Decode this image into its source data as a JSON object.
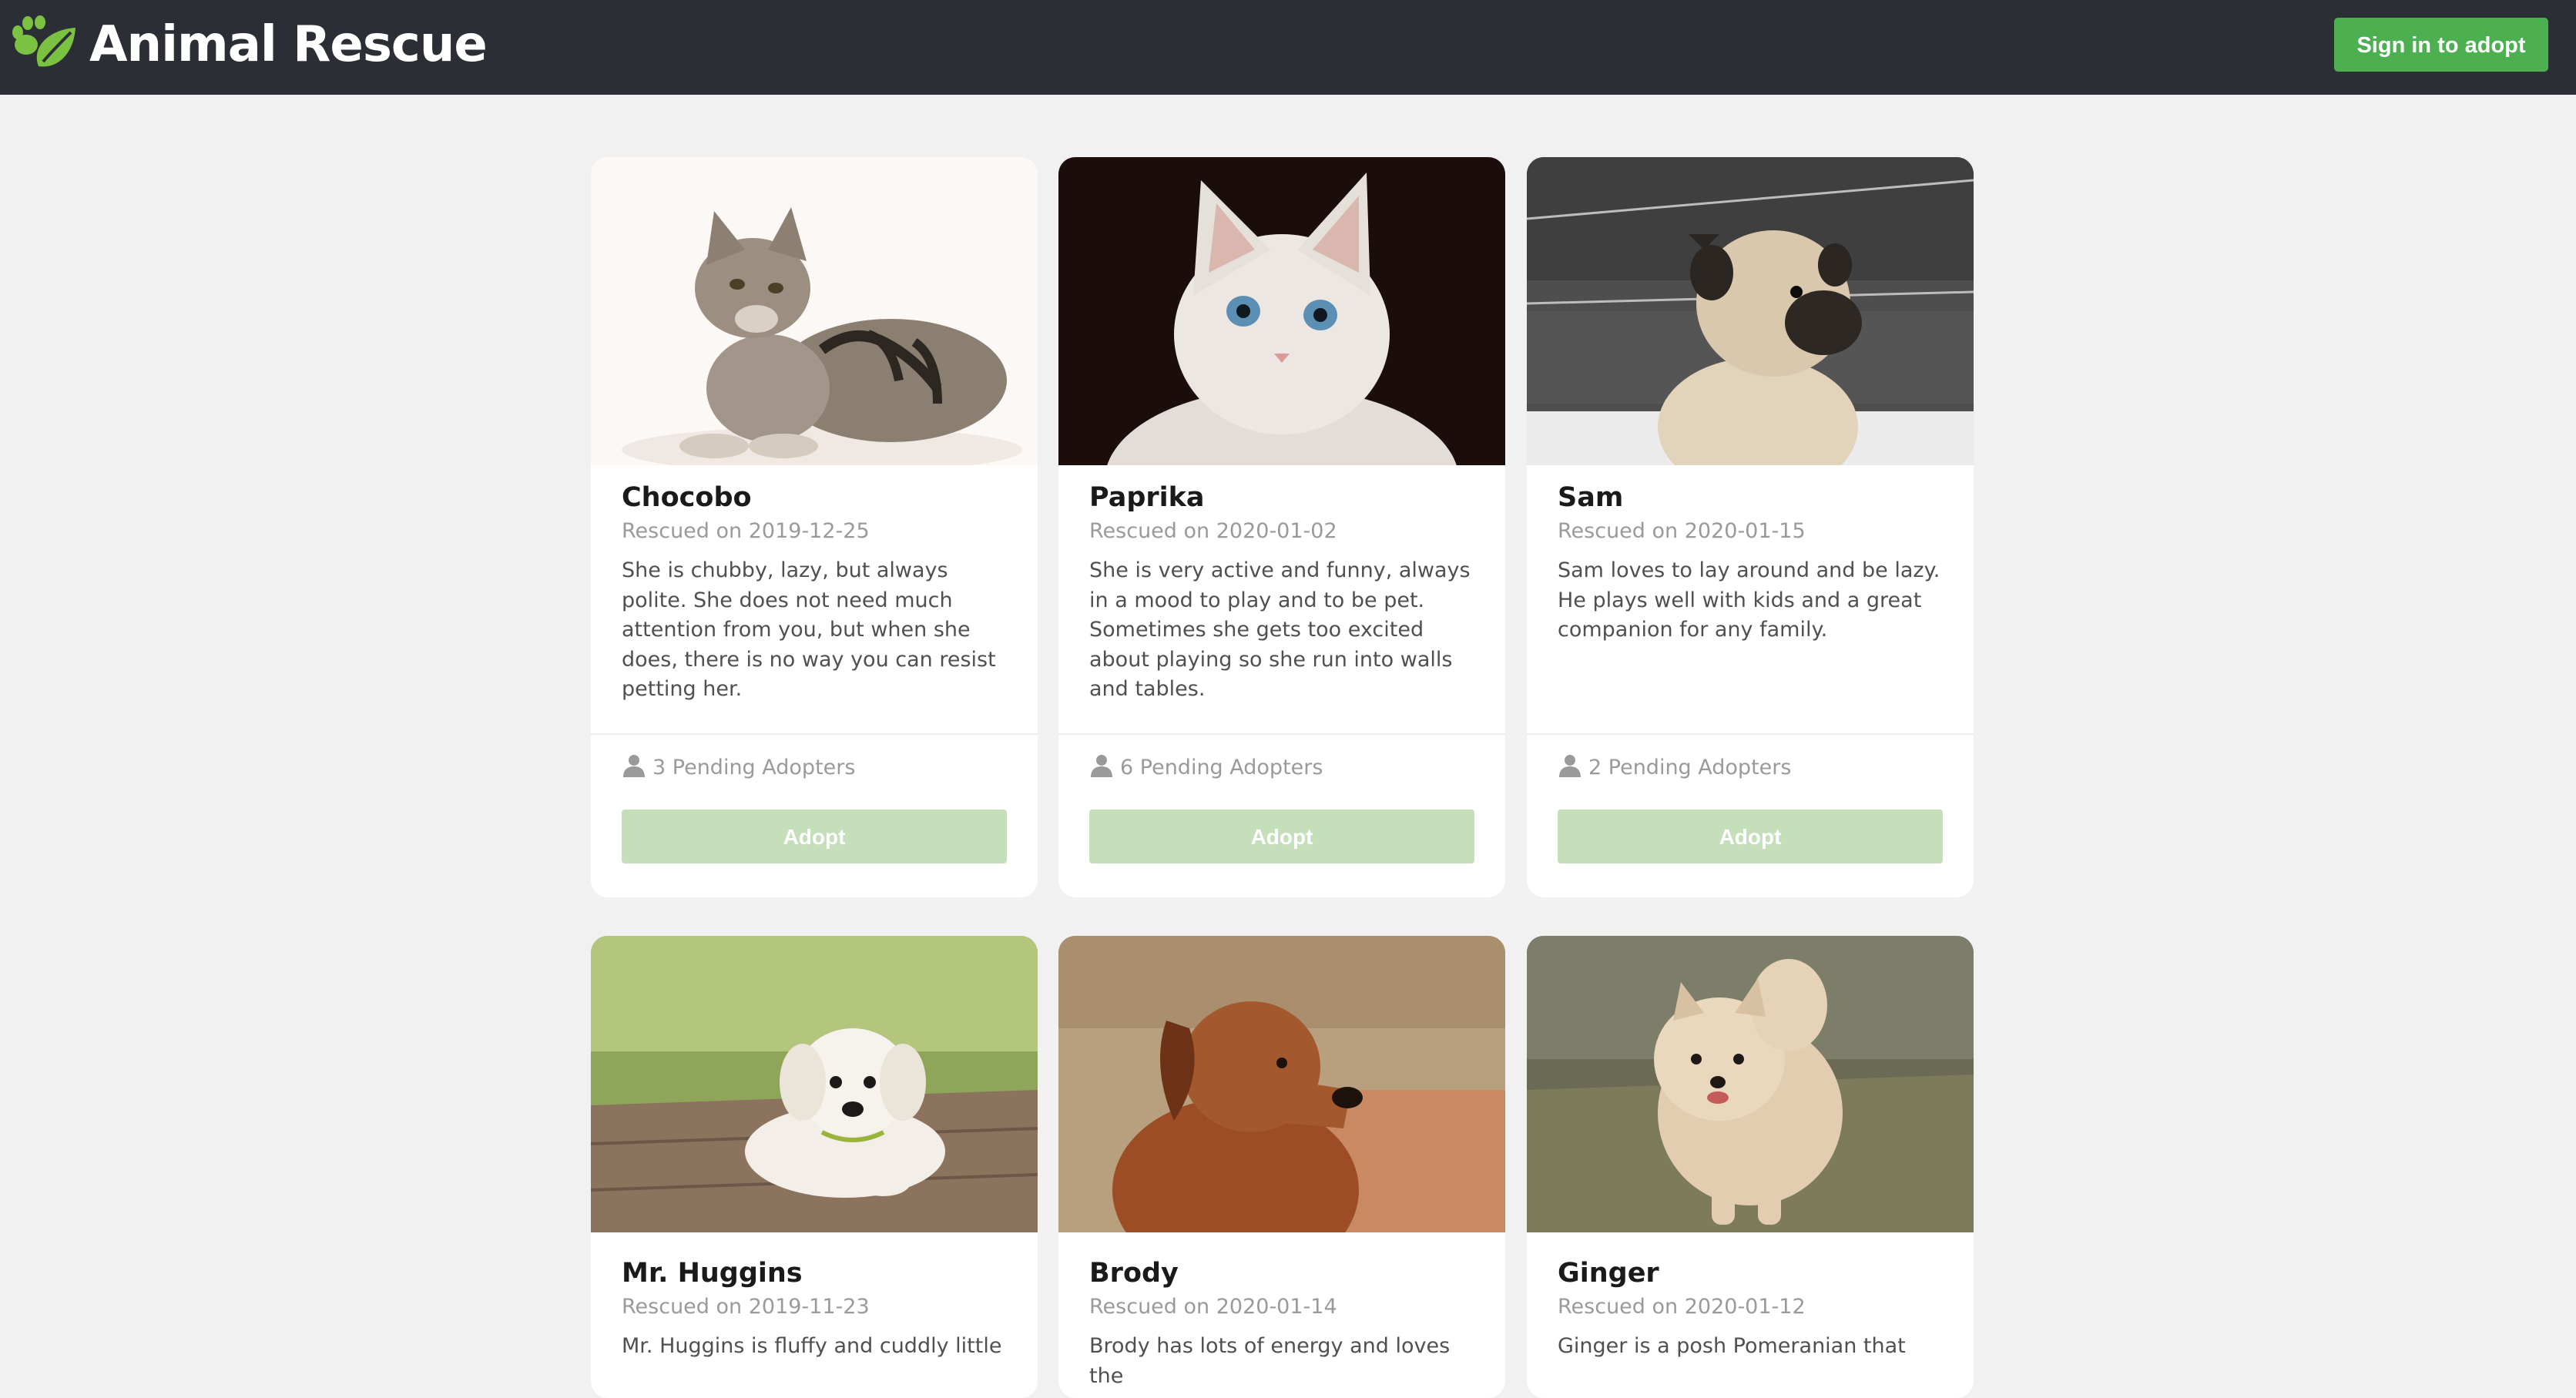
{
  "header": {
    "app_title": "Animal Rescue",
    "logo_icon": "paw-leaf-logo",
    "signin_label": "Sign in to adopt"
  },
  "colors": {
    "header_bg": "#2b2f35",
    "accent_green": "#4caf50",
    "adopt_disabled": "#c5dfbb",
    "page_bg": "#f1f1f1"
  },
  "pets": [
    {
      "name": "Chocobo",
      "rescued": "Rescued on 2019-12-25",
      "description": "She is chubby, lazy, but always polite. She does not need much attention from you, but when she does, there is no way you can resist petting her.",
      "pending": "3 Pending Adopters",
      "adopt_label": "Adopt",
      "photo": "tabby-kitten-photo"
    },
    {
      "name": "Paprika",
      "rescued": "Rescued on 2020-01-02",
      "description": "She is very active and funny, always in a mood to play and to be pet. Sometimes she gets too excited about playing so she run into walls and tables.",
      "pending": "6 Pending Adopters",
      "adopt_label": "Adopt",
      "photo": "white-kitten-photo"
    },
    {
      "name": "Sam",
      "rescued": "Rescued on 2020-01-15",
      "description": "Sam loves to lay around and be lazy. He plays well with kids and a great companion for any family.",
      "pending": "2 Pending Adopters",
      "adopt_label": "Adopt",
      "photo": "pug-photo"
    },
    {
      "name": "Mr. Huggins",
      "rescued": "Rescued on 2019-11-23",
      "description": "Mr. Huggins is fluffy and cuddly little",
      "photo": "white-puppy-photo"
    },
    {
      "name": "Brody",
      "rescued": "Rescued on 2020-01-14",
      "description": "Brody has lots of energy and loves the",
      "photo": "rhodesian-ridgeback-photo"
    },
    {
      "name": "Ginger",
      "rescued": "Rescued on 2020-01-12",
      "description": "Ginger is a posh Pomeranian that",
      "photo": "pomeranian-photo"
    }
  ]
}
